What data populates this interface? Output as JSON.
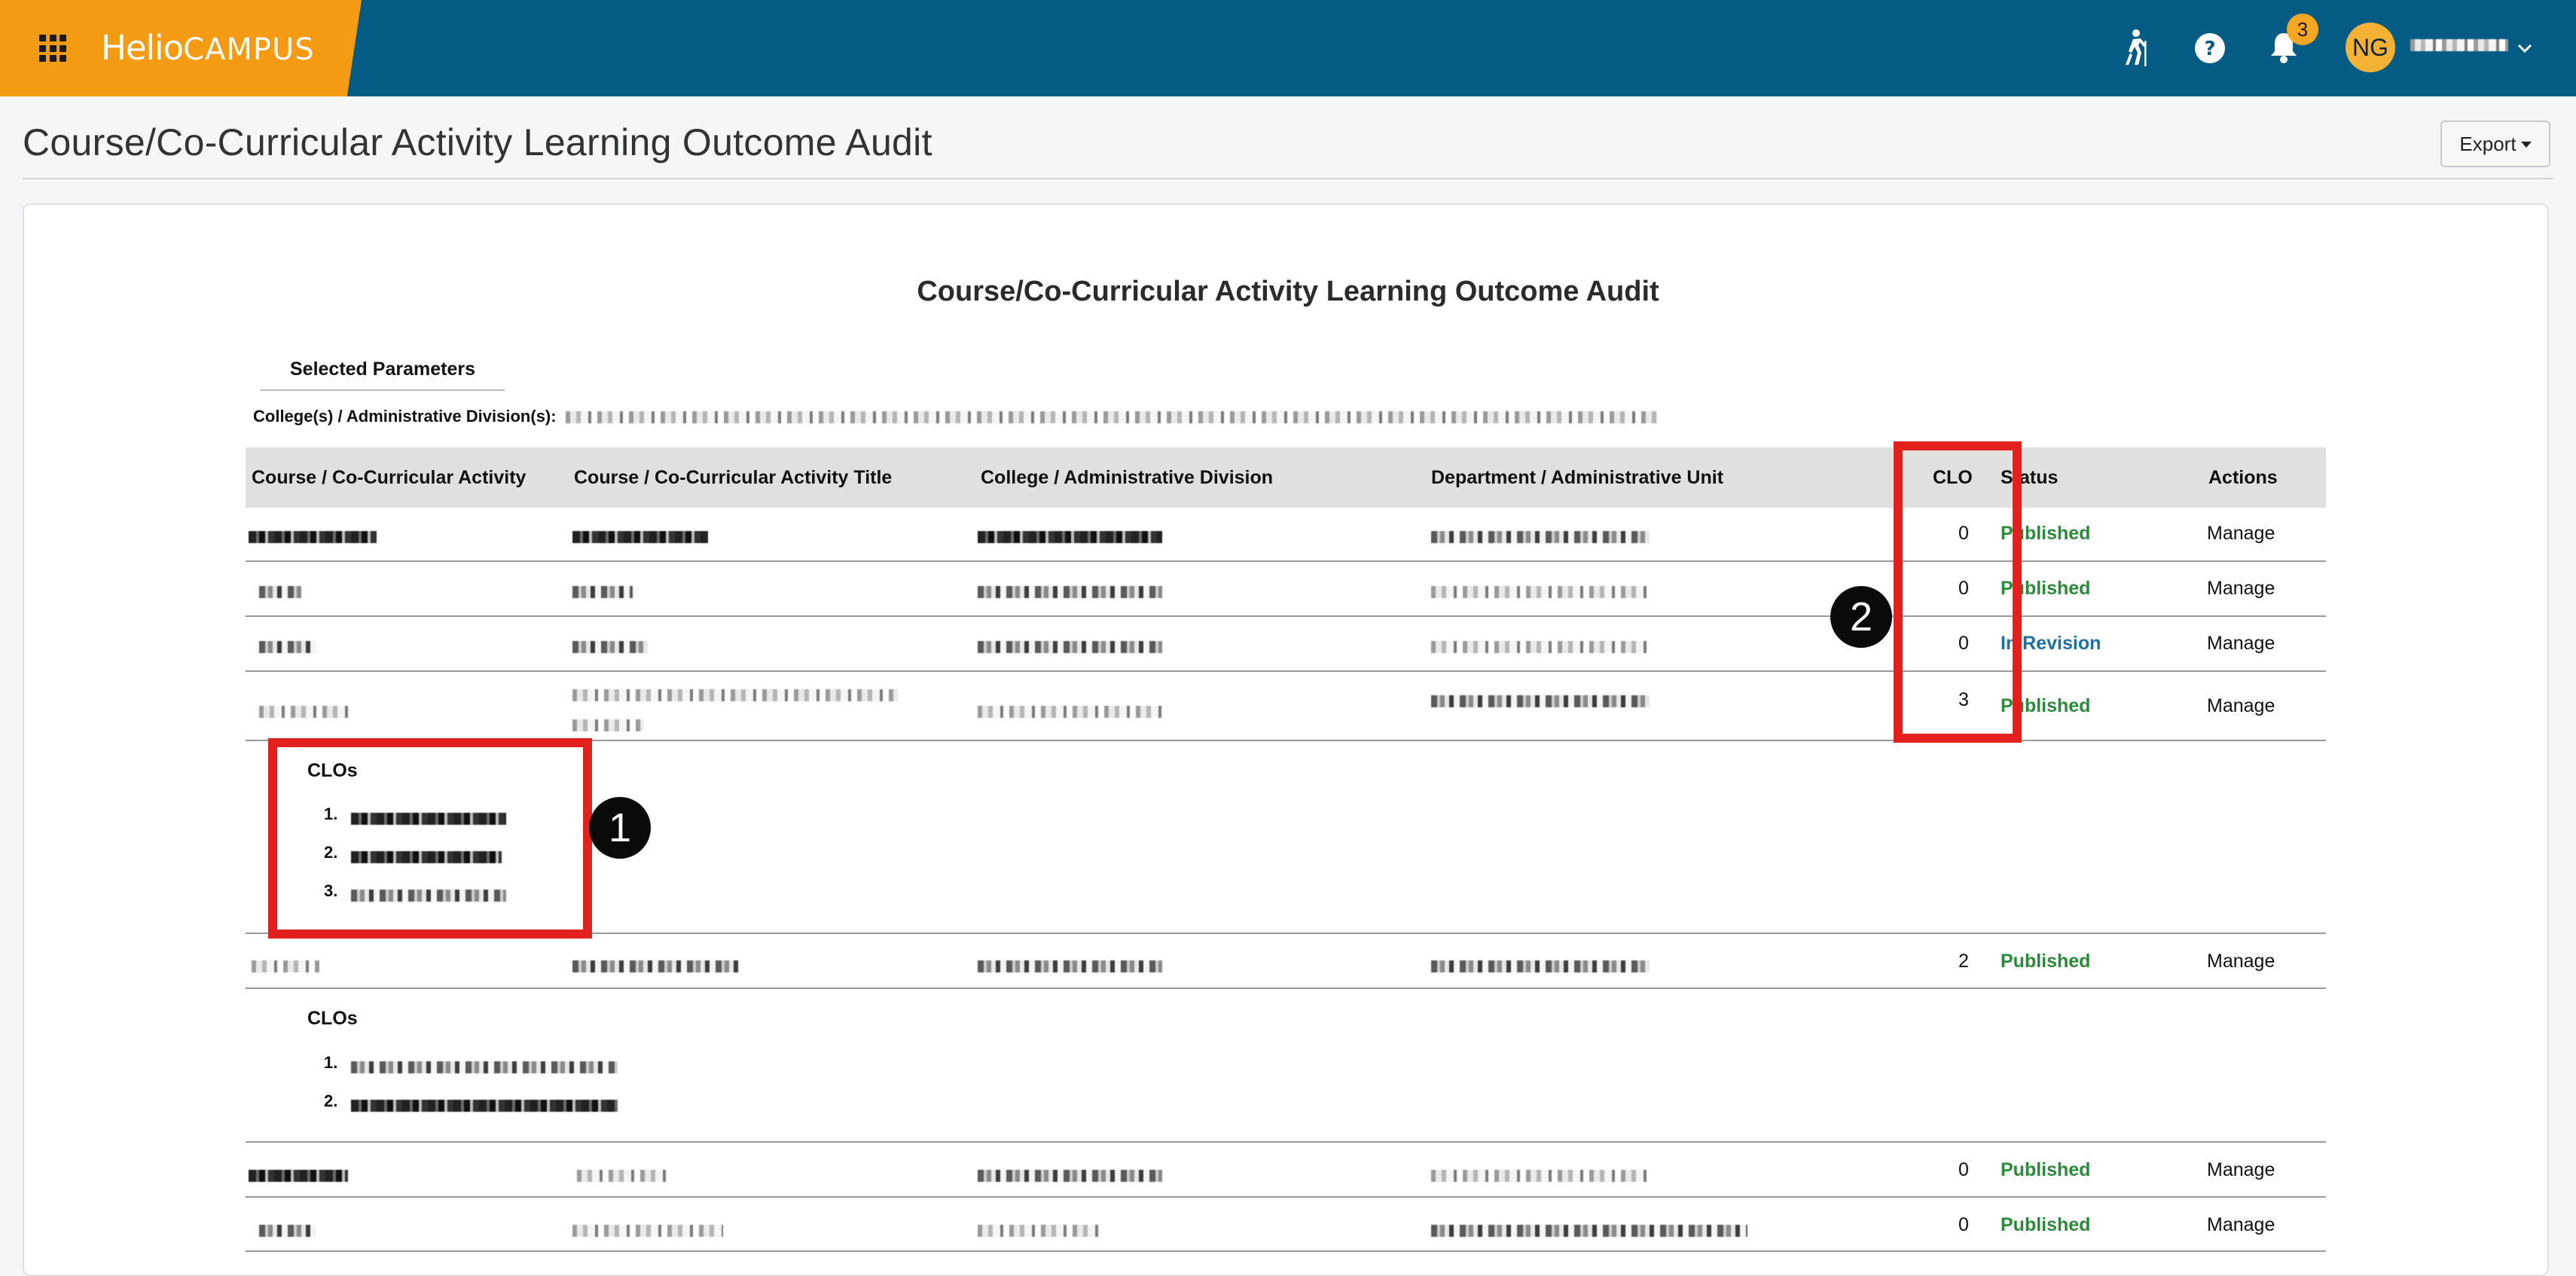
{
  "header": {
    "logo_part1": "Helio",
    "logo_part2": "CAMPUS",
    "notification_count": "3",
    "avatar_initials": "NG",
    "icons": [
      "apps-grid-icon",
      "hiking-icon",
      "help-icon",
      "bell-icon",
      "chevron-down-icon"
    ],
    "brand_color": "#f59a13",
    "bar_color": "#045c85"
  },
  "page": {
    "title": "Course/Co-Curricular Activity Learning Outcome Audit",
    "export_label": "Export"
  },
  "report": {
    "title": "Course/Co-Curricular Activity Learning Outcome Audit",
    "params_heading": "Selected Parameters",
    "params_label": "College(s) / Administrative Division(s):",
    "columns": [
      "Course / Co-Curricular Activity",
      "Course / Co-Curricular Activity Title",
      "College / Administrative Division",
      "Department / Administrative Unit",
      "CLO",
      "Status",
      "Actions"
    ],
    "clos_heading": "CLOs",
    "rows": [
      {
        "clo": "0",
        "status": "Published",
        "action": "Manage"
      },
      {
        "clo": "0",
        "status": "Published",
        "action": "Manage"
      },
      {
        "clo": "0",
        "status": "In Revision",
        "action": "Manage"
      },
      {
        "clo": "3",
        "status": "Published",
        "action": "Manage",
        "clo_list": [
          "1.",
          "2.",
          "3."
        ]
      },
      {
        "clo": "2",
        "status": "Published",
        "action": "Manage",
        "clo_list": [
          "1.",
          "2."
        ]
      },
      {
        "clo": "0",
        "status": "Published",
        "action": "Manage"
      },
      {
        "clo": "0",
        "status": "Published",
        "action": "Manage"
      }
    ]
  },
  "annotations": {
    "badge_1": "1",
    "badge_2": "2",
    "color": "#e2201d"
  },
  "status_colors": {
    "published": "#2a8a3a",
    "in_revision": "#1d6fa0"
  }
}
